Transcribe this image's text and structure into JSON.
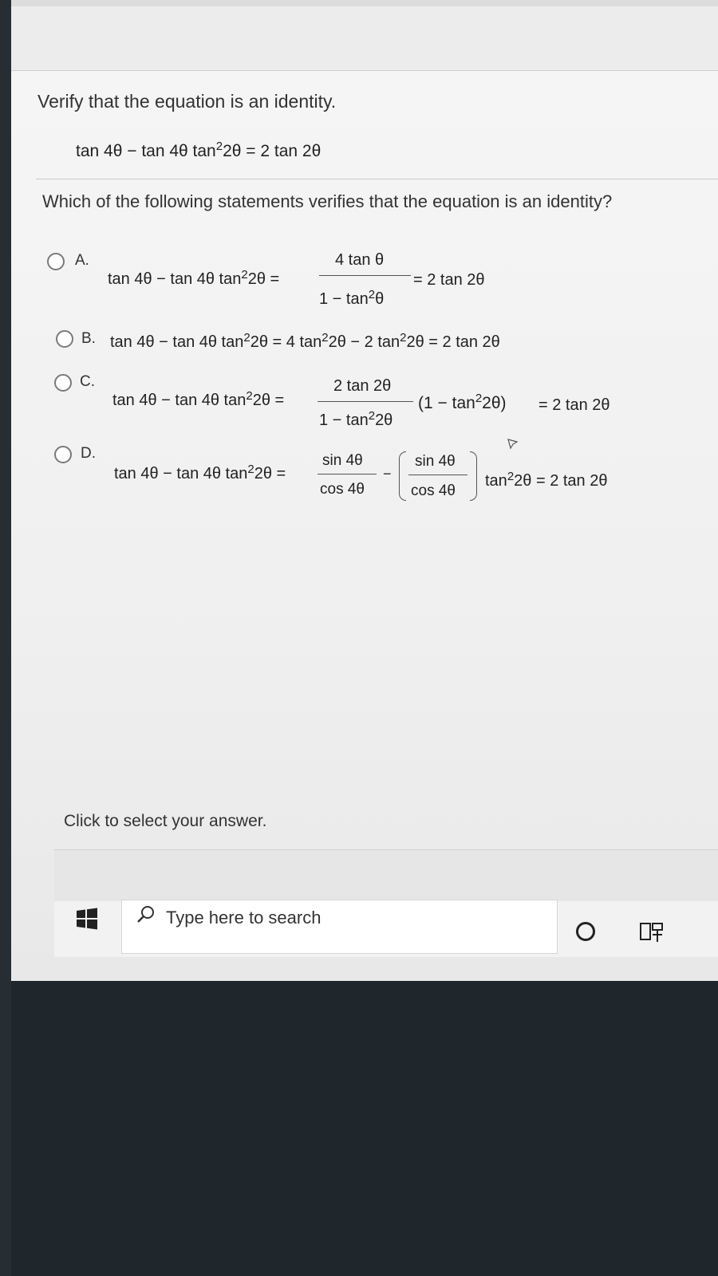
{
  "prompt": {
    "heading": "Verify that the equation is an identity.",
    "equation": {
      "lhs_a": "tan 4θ − tan 4θ tan",
      "exp": "2",
      "lhs_b": "2θ = 2 tan 2θ"
    },
    "question": "Which of the following statements verifies that the equation is an identity?"
  },
  "options": {
    "a": {
      "letter": "A.",
      "lhs": "tan 4θ − tan 4θ tan",
      "exp": "2",
      "lhs_tail": "2θ =",
      "num": "4 tan θ",
      "den": "1 − tan",
      "den_exp": "2",
      "den_tail": "θ",
      "rhs": "= 2 tan 2θ"
    },
    "b": {
      "letter": "B.",
      "p1": "tan 4θ − tan 4θ tan",
      "e1": "2",
      "p2": "2θ = 4 tan",
      "e2": "2",
      "p3": "2θ − 2 tan",
      "e3": "2",
      "p4": "2θ = 2 tan 2θ"
    },
    "c": {
      "letter": "C.",
      "lhs": "tan 4θ − tan 4θ tan",
      "exp": "2",
      "lhs_tail": "2θ =",
      "num": "2 tan 2θ",
      "den": "1 − tan",
      "den_exp": "2",
      "den_tail": "2θ",
      "paren_open": "(1 − tan",
      "paren_exp": "2",
      "paren_tail": "2θ)",
      "rhs": "= 2 tan 2θ"
    },
    "d": {
      "letter": "D.",
      "lhs": "tan 4θ − tan 4θ tan",
      "exp": "2",
      "lhs_tail": "2θ =",
      "num1": "sin 4θ",
      "den1": "cos 4θ",
      "minus": "−",
      "num2": "sin 4θ",
      "den2": "cos 4θ",
      "tail": "tan",
      "tail_exp": "2",
      "tail_rest": "2θ = 2 tan 2θ"
    }
  },
  "hint": "Click to select your answer.",
  "taskbar": {
    "search_placeholder": "Type here to search",
    "icons": [
      "windows-start-icon",
      "search-icon",
      "cortana-icon",
      "task-view-icon"
    ]
  }
}
